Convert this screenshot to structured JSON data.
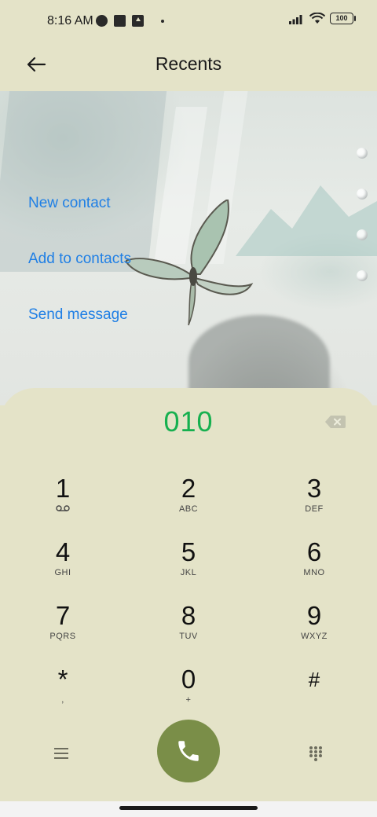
{
  "status_bar": {
    "time": "8:16 AM",
    "battery": "100",
    "left_icons": [
      "app-notification-icon",
      "square-notification-icon",
      "upload-notification-icon",
      "dot-icon"
    ],
    "right_icons": [
      "signal-icon",
      "wifi-icon",
      "battery-icon"
    ]
  },
  "header": {
    "title": "Recents",
    "back_icon": "arrow-left-icon"
  },
  "options": [
    {
      "label": "New contact"
    },
    {
      "label": "Add to contacts"
    },
    {
      "label": "Send message"
    }
  ],
  "dialer": {
    "number": "010",
    "accent_color": "#16b04f",
    "keys": [
      {
        "digit": "1",
        "letters": ""
      },
      {
        "digit": "2",
        "letters": "ABC"
      },
      {
        "digit": "3",
        "letters": "DEF"
      },
      {
        "digit": "4",
        "letters": "GHI"
      },
      {
        "digit": "5",
        "letters": "JKL"
      },
      {
        "digit": "6",
        "letters": "MNO"
      },
      {
        "digit": "7",
        "letters": "PQRS"
      },
      {
        "digit": "8",
        "letters": "TUV"
      },
      {
        "digit": "9",
        "letters": "WXYZ"
      },
      {
        "digit": "*",
        "letters": ","
      },
      {
        "digit": "0",
        "letters": "+"
      },
      {
        "digit": "#",
        "letters": ""
      }
    ],
    "voicemail_icon": "voicemail-icon",
    "call_button_color": "#7a8e48"
  },
  "colors": {
    "background": "#e4e3c8",
    "link": "#1f7fe5"
  }
}
